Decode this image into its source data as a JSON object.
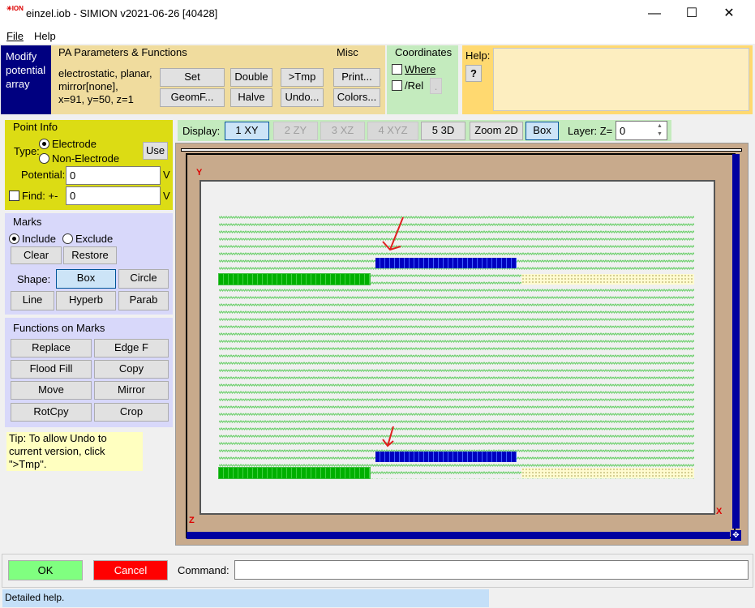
{
  "window": {
    "title": "einzel.iob - SIMION v2021-06-26 [40428]",
    "minimize": "—",
    "maximize": "☐",
    "close": "✕"
  },
  "menu": {
    "file": "File",
    "help": "Help"
  },
  "mode_label": "Modify potential array",
  "pa_params": {
    "heading": "PA Parameters & Functions",
    "info": [
      "electrostatic, planar,",
      "mirror[none],",
      "x=91, y=50, z=1"
    ],
    "set_params": "Set Params...",
    "double": "Double",
    "tmp": ">Tmp",
    "geomf": "GeomF...",
    "halve": "Halve",
    "undo": "Undo..."
  },
  "misc": {
    "heading": "Misc",
    "print": "Print...",
    "colors": "Colors..."
  },
  "coordinates": {
    "heading": "Coordinates",
    "where": "Where",
    "rel": "/Rel",
    "where_checked": false,
    "rel_checked": false,
    "small_button": "."
  },
  "help_panel": {
    "label": "Help:",
    "question": "?",
    "text": ""
  },
  "point_info": {
    "heading": "Point Info",
    "type_label": "Type:",
    "electrode": "Electrode",
    "non_electrode": "Non-Electrode",
    "selected": "Electrode",
    "use": "Use",
    "potential_label": "Potential:",
    "potential_value": "0",
    "potential_unit": "V",
    "find_label": "Find: +-",
    "find_value": "0",
    "find_unit": "V",
    "find_checked": false
  },
  "marks": {
    "heading": "Marks",
    "include": "Include",
    "exclude": "Exclude",
    "selected": "Include",
    "clear": "Clear",
    "restore": "Restore",
    "shape_label": "Shape:",
    "box": "Box",
    "circle": "Circle",
    "line": "Line",
    "hyperb": "Hyperb",
    "parab": "Parab",
    "selected_shape": "Box"
  },
  "functions": {
    "heading": "Functions on Marks",
    "replace": "Replace",
    "edge_f": "Edge F",
    "flood_fill": "Flood Fill",
    "copy": "Copy",
    "move": "Move",
    "mirror": "Mirror",
    "rotcpy": "RotCpy",
    "crop": "Crop"
  },
  "tip": "Tip: To allow Undo to current version, click \">Tmp\".",
  "display": {
    "label": "Display:",
    "views": [
      "1 XY",
      "2 ZY",
      "3 XZ",
      "4 XYZ",
      "5 3D"
    ],
    "active": "1 XY",
    "zoom2d": "Zoom 2D",
    "box": "Box",
    "layer_label": "Layer: Z=",
    "layer_value": "0"
  },
  "canvas": {
    "axis_y": "Y",
    "axis_x": "X",
    "axis_z": "Z",
    "colors": {
      "electrode_green": "#00b000",
      "electrode_blue": "#0000c0",
      "non_electrode": "#70d070",
      "frame": "#c8aa8c"
    }
  },
  "footer": {
    "ok": "OK",
    "cancel": "Cancel",
    "command_label": "Command:",
    "command_value": ""
  },
  "status": "Detailed help."
}
